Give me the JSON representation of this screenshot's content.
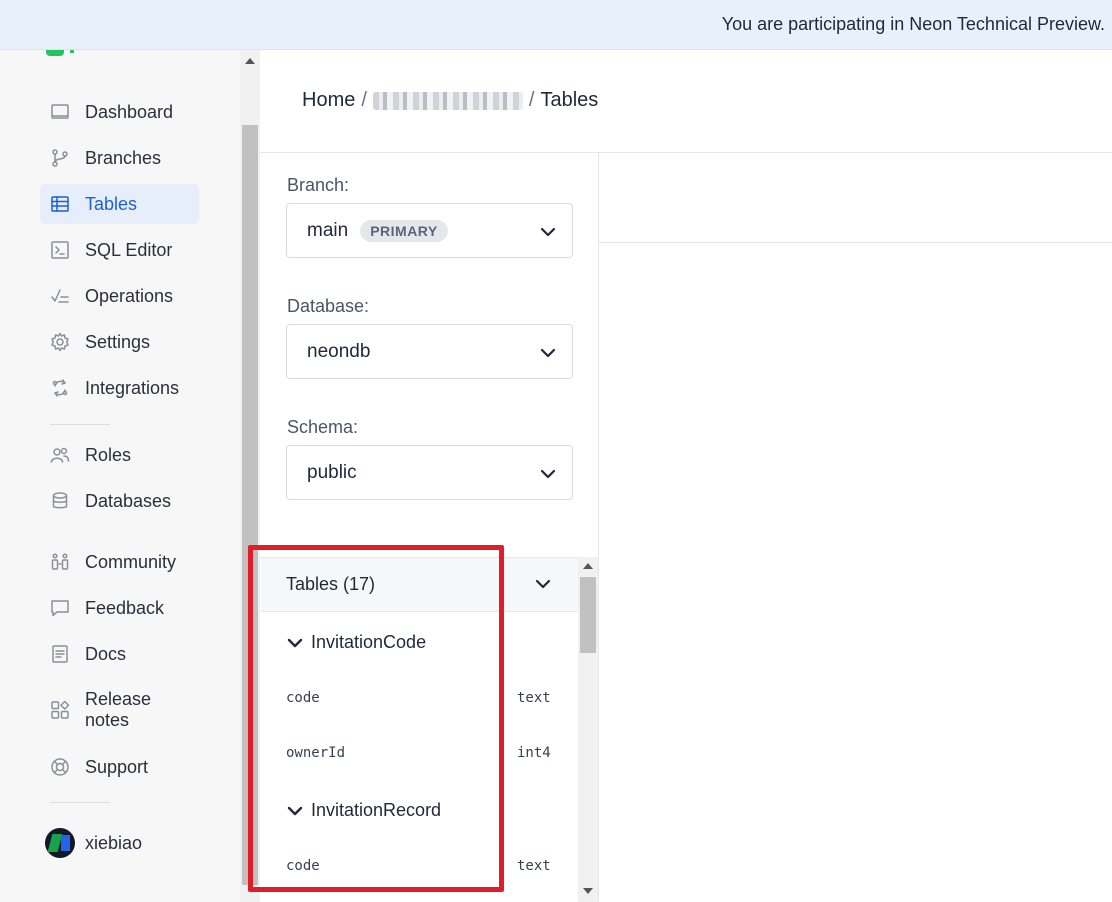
{
  "banner": {
    "text": "You are participating in Neon Technical Preview."
  },
  "sidebar": {
    "items": [
      {
        "label": "Dashboard",
        "icon": "dashboard-icon",
        "active": false
      },
      {
        "label": "Branches",
        "icon": "branches-icon",
        "active": false
      },
      {
        "label": "Tables",
        "icon": "tables-icon",
        "active": true
      },
      {
        "label": "SQL Editor",
        "icon": "sql-editor-icon",
        "active": false
      },
      {
        "label": "Operations",
        "icon": "operations-icon",
        "active": false
      },
      {
        "label": "Settings",
        "icon": "gear-icon",
        "active": false
      },
      {
        "label": "Integrations",
        "icon": "integrations-icon",
        "active": false
      },
      {
        "label": "Roles",
        "icon": "roles-icon",
        "active": false
      },
      {
        "label": "Databases",
        "icon": "database-icon",
        "active": false
      },
      {
        "label": "Community",
        "icon": "community-icon",
        "active": false
      },
      {
        "label": "Feedback",
        "icon": "feedback-icon",
        "active": false
      },
      {
        "label": "Docs",
        "icon": "docs-icon",
        "active": false
      },
      {
        "label": "Release\nnotes",
        "icon": "release-notes-icon",
        "active": false
      },
      {
        "label": "Support",
        "icon": "support-icon",
        "active": false
      }
    ],
    "user": {
      "name": "xiebiao"
    }
  },
  "breadcrumb": {
    "home": "Home",
    "separator": "/",
    "current": "Tables"
  },
  "filters": {
    "branch": {
      "label": "Branch:",
      "value": "main",
      "badge": "PRIMARY"
    },
    "database": {
      "label": "Database:",
      "value": "neondb"
    },
    "schema": {
      "label": "Schema:",
      "value": "public"
    }
  },
  "tables": {
    "header": "Tables (17)",
    "list": [
      {
        "name": "InvitationCode",
        "columns": [
          {
            "name": "code",
            "type": "text"
          },
          {
            "name": "ownerId",
            "type": "int4"
          }
        ]
      },
      {
        "name": "InvitationRecord",
        "columns": [
          {
            "name": "code",
            "type": "text"
          }
        ]
      }
    ]
  },
  "colors": {
    "accent": "#1d5fd6",
    "highlight": "#e11d2a",
    "banner_bg": "#e8f0fb"
  }
}
